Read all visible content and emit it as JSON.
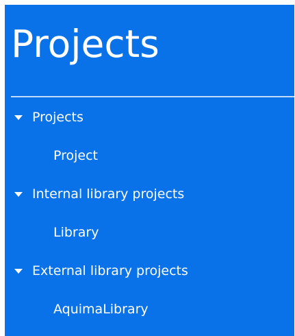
{
  "panel": {
    "title": "Projects"
  },
  "tree": {
    "groups": [
      {
        "label": "Projects",
        "icon": "caret-down-icon",
        "children": [
          {
            "label": "Project"
          }
        ]
      },
      {
        "label": "Internal library projects",
        "icon": "caret-down-icon",
        "children": [
          {
            "label": "Library"
          }
        ]
      },
      {
        "label": "External library projects",
        "icon": "caret-down-icon",
        "children": [
          {
            "label": "AquimaLibrary"
          }
        ]
      }
    ]
  },
  "colors": {
    "panel_background": "#0a72e8",
    "text": "#ffffff"
  }
}
